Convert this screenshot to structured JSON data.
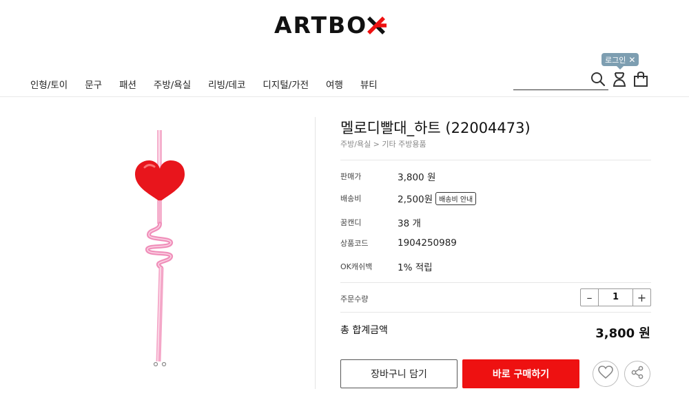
{
  "header": {
    "logo_text": "ARTBO",
    "logo_brand_color": "#ee1111",
    "nav": [
      "인형/토이",
      "문구",
      "패션",
      "주방/욕실",
      "리빙/데코",
      "디지털/가전",
      "여행",
      "뷰티"
    ],
    "login_bubble": "로그인"
  },
  "product": {
    "title": "멜로디빨대_하트 (22004473)",
    "breadcrumb": "주방/욕실 > 기타 주방용품",
    "info": [
      {
        "label": "판매가",
        "value": "3,800 원"
      },
      {
        "label": "배송비",
        "value": "2,500원",
        "button": "배송비 안내"
      },
      {
        "label": "꿈캔디",
        "value": "38 개"
      },
      {
        "label": "상품코드",
        "value": "1904250989"
      },
      {
        "label": "OK캐쉬백",
        "value": "1% 적립"
      }
    ],
    "quantity_label": "주문수량",
    "quantity": "1",
    "total_label": "총 합계금액",
    "total_value": "3,800 원",
    "cart_button": "장바구니 담기",
    "buy_button": "바로 구매하기"
  },
  "icons": {
    "search": "search-icon",
    "user": "user-icon",
    "bag": "shopping-bag-icon",
    "heart": "heart-icon",
    "share": "share-icon"
  }
}
